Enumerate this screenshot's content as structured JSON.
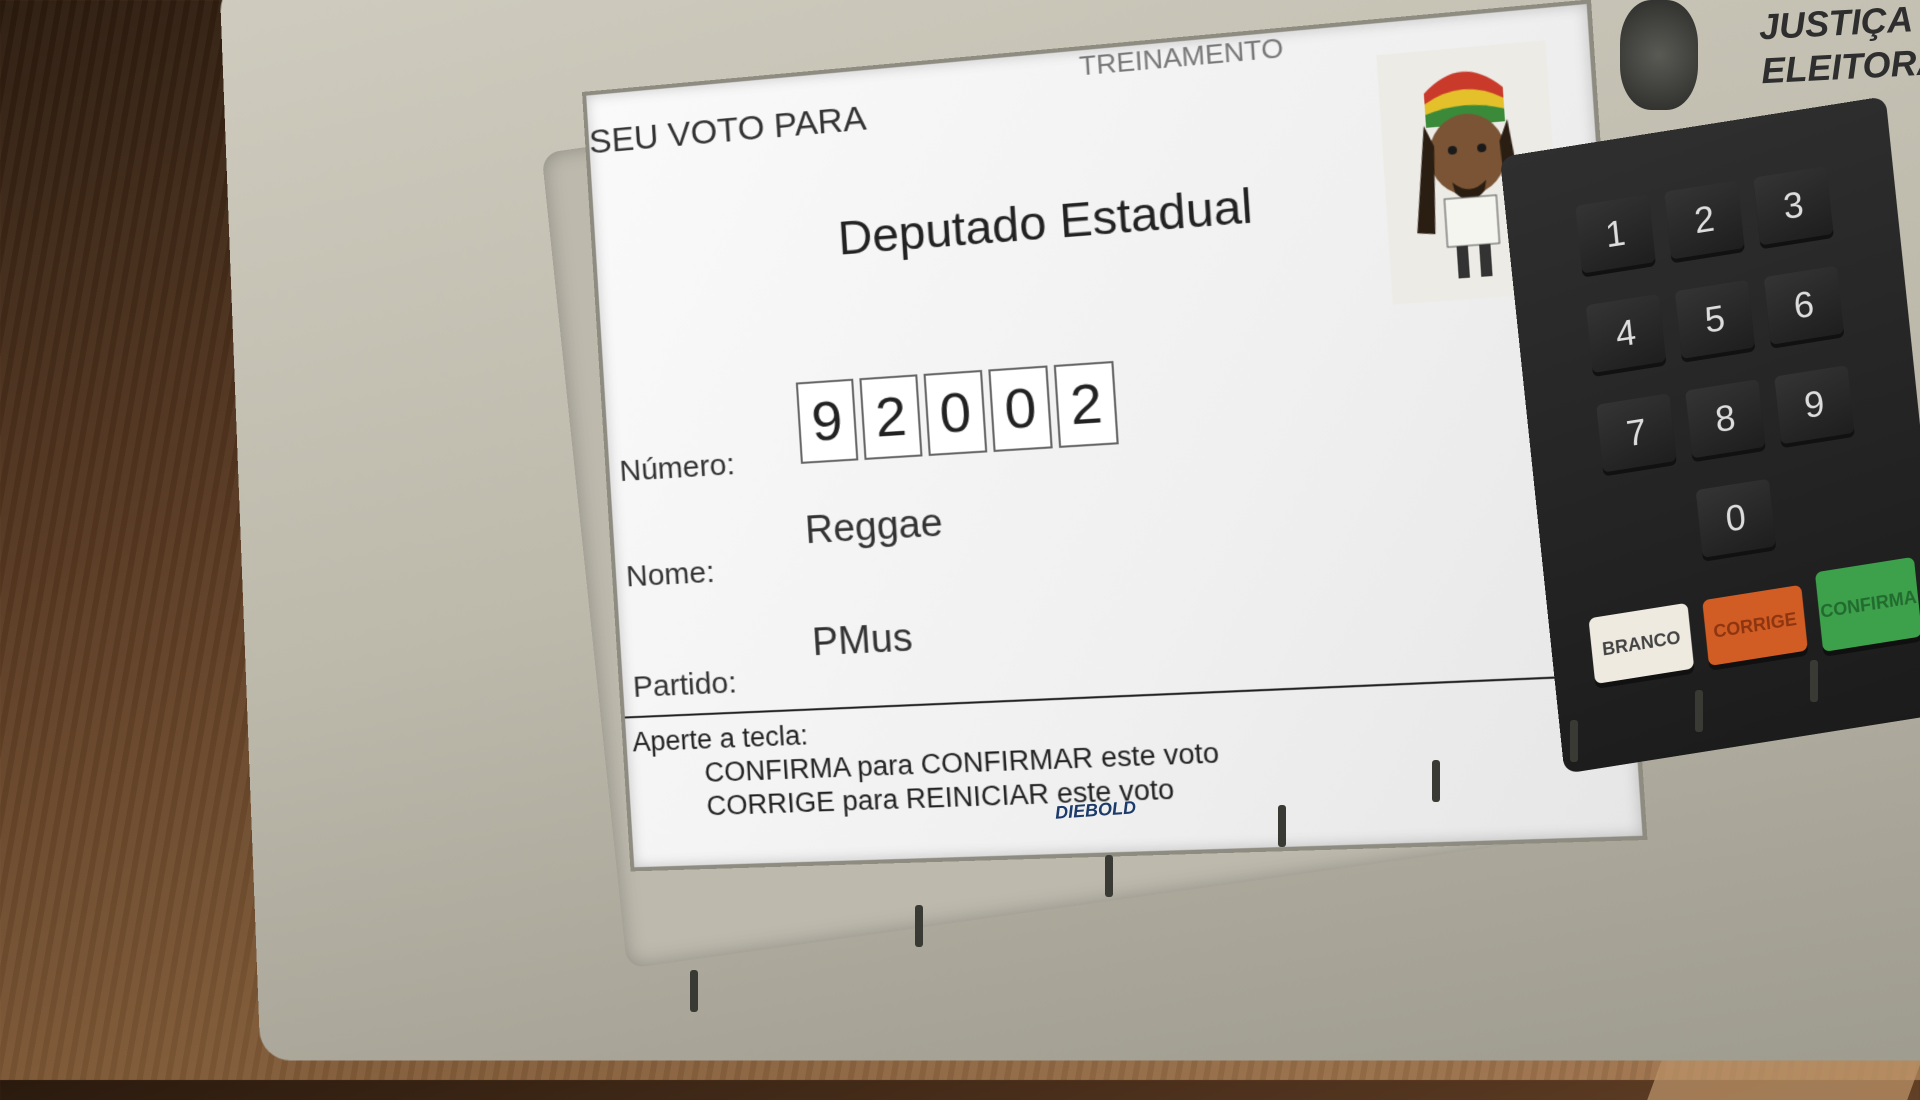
{
  "screen": {
    "header": "SEU VOTO PARA",
    "mode": "TREINAMENTO",
    "office": "Deputado Estadual",
    "number_label": "Número:",
    "number_digits": [
      "9",
      "2",
      "0",
      "0",
      "2"
    ],
    "name_label": "Nome:",
    "name_value": "Reggae",
    "party_label": "Partido:",
    "party_value": "PMus",
    "footer": {
      "intro": "Aperte a tecla:",
      "confirm": "CONFIRMA para CONFIRMAR este voto",
      "correct": "CORRIGE para REINICIAR este voto"
    }
  },
  "brand": {
    "line1": "JUSTIÇA",
    "line2": "ELEITORAL"
  },
  "maker": "DIEBOLD",
  "keypad": {
    "keys": [
      "1",
      "2",
      "3",
      "4",
      "5",
      "6",
      "7",
      "8",
      "9",
      "0"
    ],
    "branco": "BRANCO",
    "corrige": "CORRIGE",
    "confirma": "CONFIRMA"
  },
  "colors": {
    "branco_key": "#eeeae0",
    "corrige_key": "#d25d24",
    "confirma_key": "#3da04b"
  }
}
